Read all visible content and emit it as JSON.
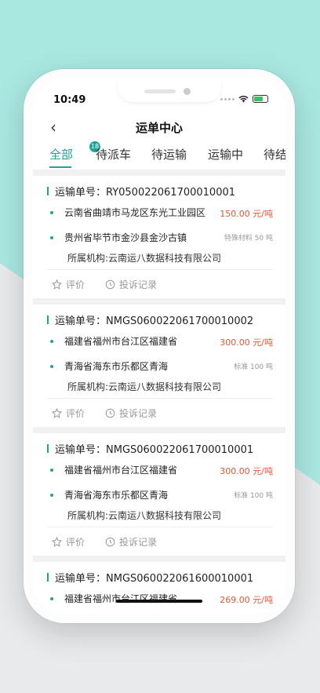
{
  "status": {
    "time": "10:49"
  },
  "nav": {
    "back": "‹",
    "title": "运单中心"
  },
  "tabs": [
    {
      "label": "全部",
      "badge": "18"
    },
    {
      "label": "待派车"
    },
    {
      "label": "待运输"
    },
    {
      "label": "运输中"
    },
    {
      "label": "待结"
    }
  ],
  "orders": [
    {
      "header": "运输单号：RY050022061700010001",
      "from": "云南省曲靖市马龙区东光工业园区",
      "price": "150.00 元/吨",
      "to": "贵州省毕节市金沙县金沙古镇",
      "cargo": "特殊材料 50 吨",
      "org": "所属机构:云南运八数据科技有限公司",
      "rate": "评价",
      "complaint": "投诉记录"
    },
    {
      "header": "运输单号：NMGS060022061700010002",
      "from": "福建省福州市台江区福建省",
      "price": "300.00 元/吨",
      "to": "青海省海东市乐都区青海",
      "cargo": "标准 100 吨",
      "org": "所属机构:云南运八数据科技有限公司",
      "rate": "评价",
      "complaint": "投诉记录"
    },
    {
      "header": "运输单号：NMGS060022061700010001",
      "from": "福建省福州市台江区福建省",
      "price": "300.00 元/吨",
      "to": "青海省海东市乐都区青海",
      "cargo": "标准 100 吨",
      "org": "所属机构:云南运八数据科技有限公司",
      "rate": "评价",
      "complaint": "投诉记录"
    },
    {
      "header": "运输单号：NMGS060022061600010001",
      "from": "福建省福州市台江区福建省",
      "price": "269.00 元/吨"
    }
  ],
  "colors": {
    "accent": "#1aa59a",
    "price": "#e8553b"
  }
}
